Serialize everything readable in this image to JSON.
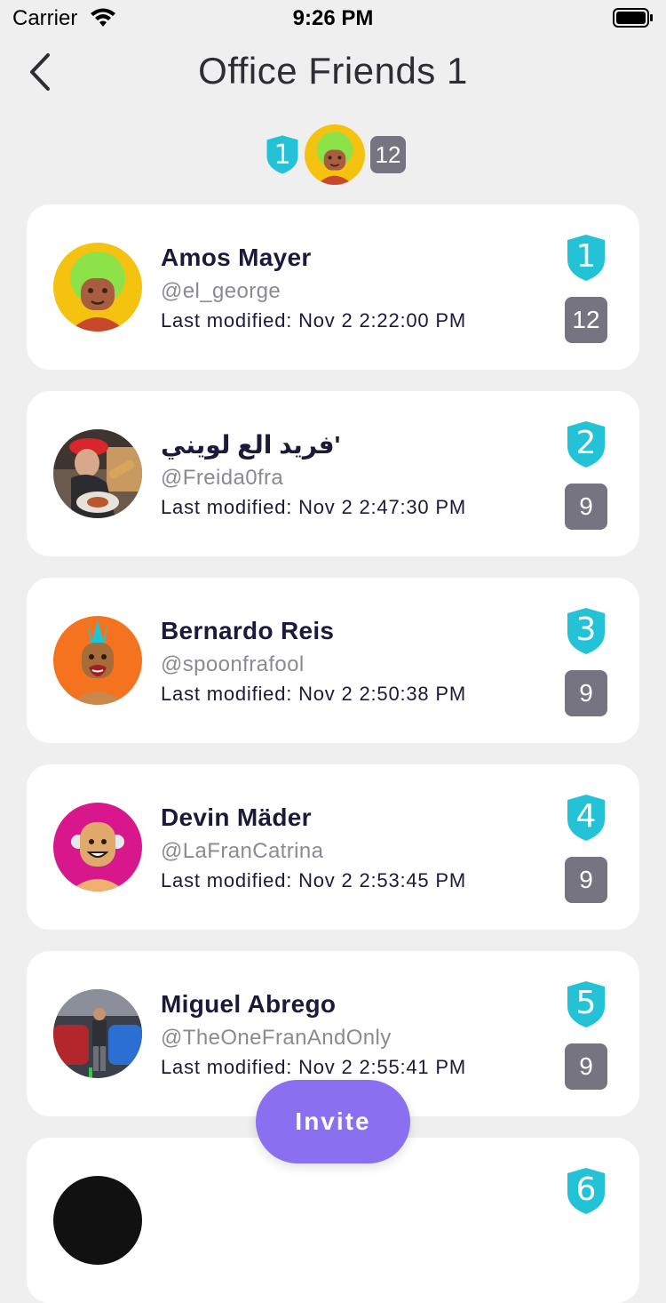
{
  "status_bar": {
    "carrier": "Carrier",
    "time": "9:26 PM"
  },
  "header": {
    "title": "Office Friends 1"
  },
  "summary": {
    "rank": "1",
    "count": "12"
  },
  "friends": [
    {
      "name": "Amos Mayer",
      "handle": "@el_george",
      "modified": "Last modified: Nov 2 2:22:00 PM",
      "rank": "1",
      "count": "12"
    },
    {
      "name": "فريد الع لويني'",
      "handle": "@Freida0fra",
      "modified": "Last modified: Nov 2 2:47:30 PM",
      "rank": "2",
      "count": "9"
    },
    {
      "name": "Bernardo Reis",
      "handle": "@spoonfrafool",
      "modified": "Last modified: Nov 2 2:50:38 PM",
      "rank": "3",
      "count": "9"
    },
    {
      "name": "Devin Mäder",
      "handle": "@LaFranCatrina",
      "modified": "Last modified: Nov 2 2:53:45 PM",
      "rank": "4",
      "count": "9"
    },
    {
      "name": "Miguel Abrego",
      "handle": "@TheOneFranAndOnly",
      "modified": "Last modified: Nov 2 2:55:41 PM",
      "rank": "5",
      "count": "9"
    },
    {
      "name": "",
      "handle": "",
      "modified": "",
      "rank": "6",
      "count": ""
    }
  ],
  "invite": {
    "label": "Invite"
  },
  "colors": {
    "accent": "#8b6ff1",
    "badge": "#24c2d6",
    "count_badge": "#767480",
    "background": "#efeff0"
  }
}
